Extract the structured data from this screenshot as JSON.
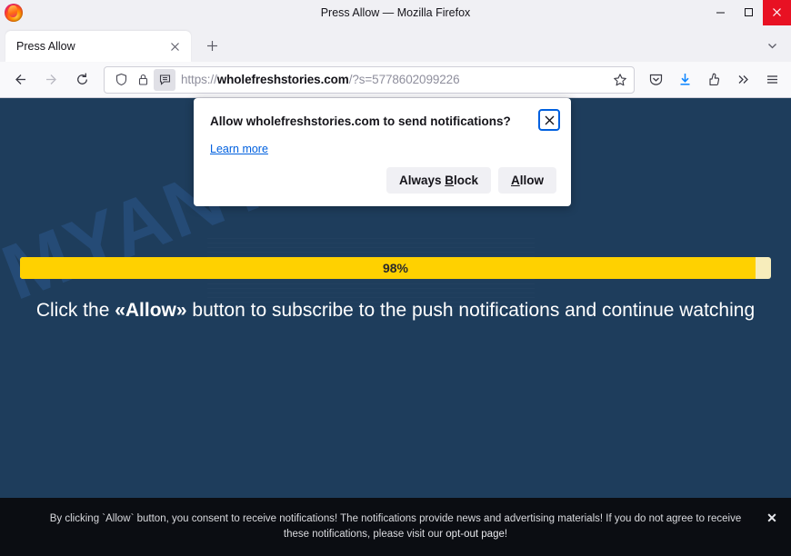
{
  "window": {
    "title": "Press Allow — Mozilla Firefox",
    "minimize_label": "Minimize",
    "maximize_label": "Maximize",
    "close_label": "Close"
  },
  "tabbar": {
    "tab_title": "Press Allow",
    "tab_close_label": "Close tab",
    "newtab_label": "New tab",
    "tablist_label": "List all tabs"
  },
  "toolbar": {
    "back_label": "Go back one page",
    "forward_label": "Go forward one page",
    "reload_label": "Reload current page",
    "shield_label": "Tracking protection",
    "lock_label": "Connection secure",
    "permission_label": "Notification permission requested",
    "url_prefix": "https://",
    "url_domain": "wholefreshstories.com",
    "url_rest": "/?s=5778602099226",
    "url_full": "https://wholefreshstories.com/?s=5778602099226",
    "bookmark_label": "Bookmark this page",
    "pocket_label": "Save to Pocket",
    "downloads_label": "Downloads",
    "account_label": "Account",
    "overflow_label": "More tools",
    "menu_label": "Open application menu"
  },
  "permission_popup": {
    "heading": "Allow wholefreshstories.com to send notifications?",
    "learn_more": "Learn more",
    "block_button": "Always Block",
    "block_button_accesskey": "B",
    "allow_button": "Allow",
    "allow_button_accesskey": "A",
    "close_label": "Close"
  },
  "page": {
    "watermark": "MYANTISPYWARE.COM",
    "progress_label": "98%",
    "progress_percent": 98,
    "cta_before": "Click the ",
    "cta_bold": "«Allow»",
    "cta_after": " button to subscribe to the push notifications and continue watching",
    "background_color": "#1e3d5c",
    "progress_fill_color": "#ffd100",
    "progress_track_color": "#f7edbb"
  },
  "consent_bar": {
    "text_before": "By clicking `Allow` button, you consent to receive notifications! The notifications provide news and advertising materials! If you do not agree to receive these notifications, please visit our ",
    "link": "opt-out page",
    "text_after": "!",
    "close_label": "×",
    "close_glyph": "✕"
  }
}
